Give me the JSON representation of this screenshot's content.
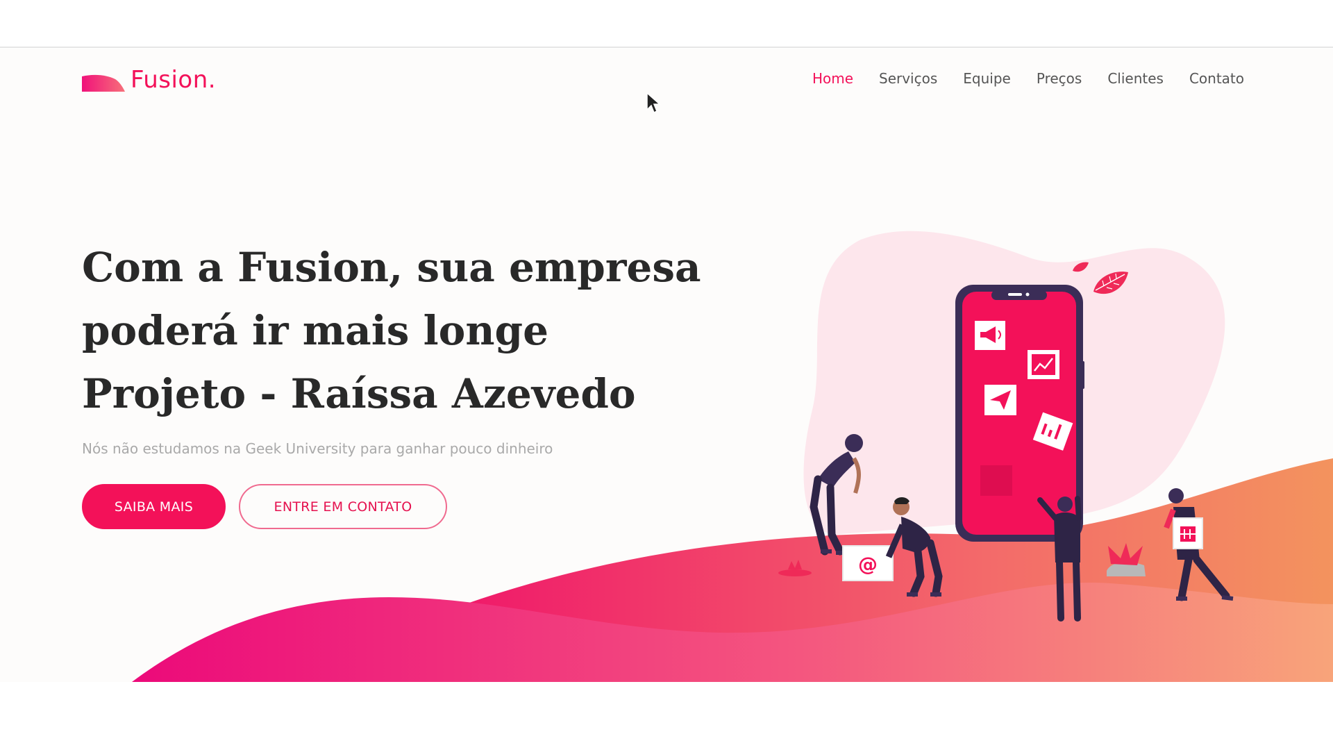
{
  "brand": {
    "name": "Fusion.",
    "color": "#f31159"
  },
  "nav": {
    "items": [
      {
        "label": "Home",
        "active": true
      },
      {
        "label": "Serviços",
        "active": false
      },
      {
        "label": "Equipe",
        "active": false
      },
      {
        "label": "Preços",
        "active": false
      },
      {
        "label": "Clientes",
        "active": false
      },
      {
        "label": "Contato",
        "active": false
      }
    ]
  },
  "hero": {
    "title_lines": [
      "Com a Fusion, sua empresa",
      "poderá ir mais longe",
      "Projeto - Raíssa Azevedo"
    ],
    "subtitle": "Nós não estudamos na Geek University para ganhar pouco dinheiro",
    "primary_button": "SAIBA MAIS",
    "secondary_button": "ENTRE EM CONTATO"
  },
  "illustration": {
    "phone_icons": [
      "megaphone-icon",
      "chart-icon",
      "paper-plane-icon",
      "analytics-card-icon"
    ],
    "at_symbol": "@"
  },
  "colors": {
    "accent": "#f31159",
    "wave_start": "#f0197a",
    "wave_end": "#f7a06e",
    "blob": "#fde6ec"
  }
}
